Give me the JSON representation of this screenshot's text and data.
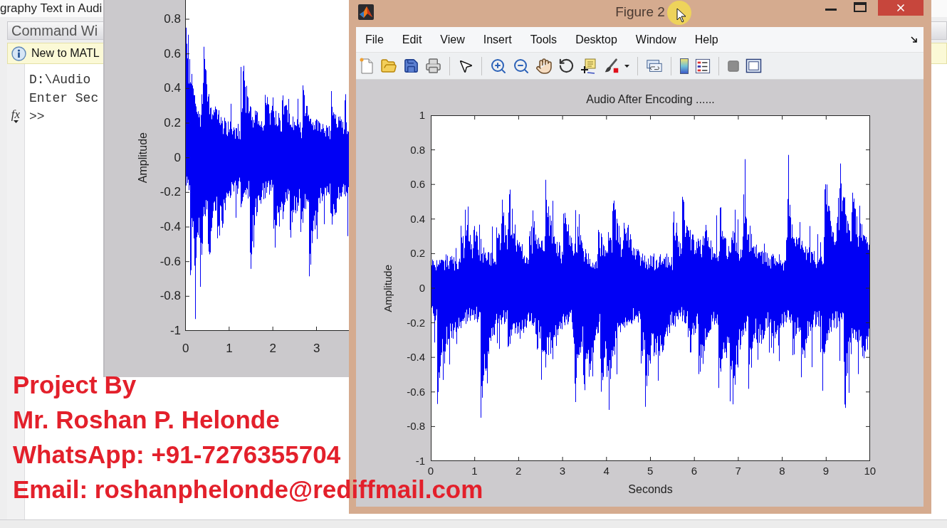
{
  "main_window": {
    "title": "graphy Text in Audi",
    "command_window": {
      "title": "Command Wi",
      "notice": "New to MATL",
      "lines": [
        "D:\\Audio",
        "Enter Sec"
      ],
      "function_button": "fx",
      "prompt": ">>"
    }
  },
  "figure_1": {
    "plot": {
      "ylabel": "Amplitude",
      "yticks": [
        "0.8",
        "0.6",
        "0.4",
        "0.2",
        "0",
        "-0.2",
        "-0.4",
        "-0.6",
        "-0.8",
        "-1"
      ],
      "xticks": [
        "0",
        "1",
        "2",
        "3"
      ]
    }
  },
  "figure_2": {
    "title": "Figure 2",
    "menu": [
      "File",
      "Edit",
      "View",
      "Insert",
      "Tools",
      "Desktop",
      "Window",
      "Help"
    ],
    "plot": {
      "title": "Audio After Encoding ......",
      "ylabel": "Amplitude",
      "xlabel": "Seconds",
      "yticks": [
        "1",
        "0.8",
        "0.6",
        "0.4",
        "0.2",
        "0",
        "-0.2",
        "-0.4",
        "-0.6",
        "-0.8",
        "-1"
      ],
      "xticks": [
        "0",
        "1",
        "2",
        "3",
        "4",
        "5",
        "6",
        "7",
        "8",
        "9",
        "10"
      ]
    }
  },
  "caption": [
    "Project By",
    "Mr. Roshan P. Helonde",
    "WhatsApp: +91-7276355704",
    "Email: roshanphelonde@rediffmail.com"
  ]
}
